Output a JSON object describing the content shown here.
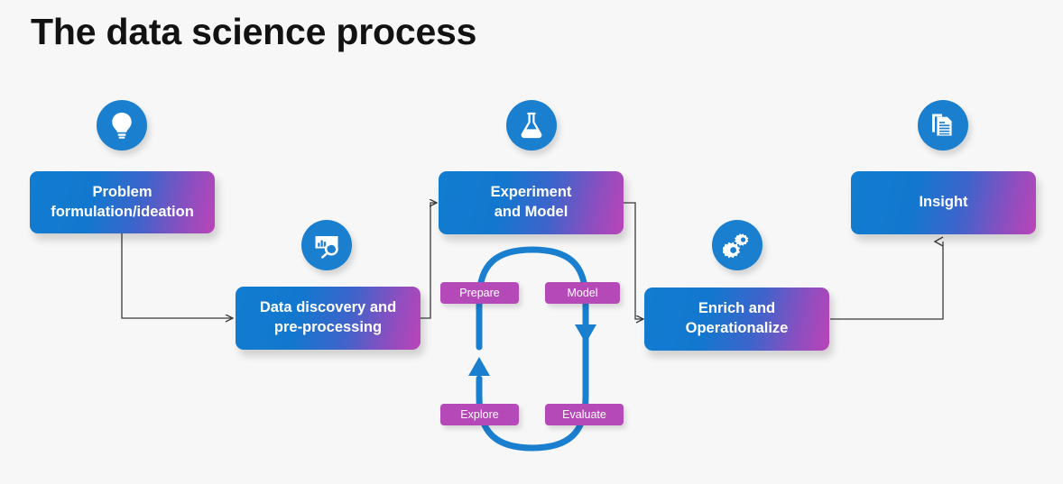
{
  "page": {
    "title": "The data science process",
    "background_color": "#f7f7f7",
    "title_color": "#121212"
  },
  "theme": {
    "box_gradient_start": "#117cd0",
    "box_gradient_end": "#bb44b8",
    "icon_circle_color": "#1b7fd0",
    "pill_color": "#b549b8",
    "cycle_arrow_color": "#1b7fd0",
    "connector_color": "#3a3a3a",
    "box_text_color": "#ffffff",
    "pill_text_color": "#ffffff"
  },
  "stages": [
    {
      "id": "problem",
      "icon": "lightbulb-icon",
      "lines": [
        "Problem",
        "formulation/ideation"
      ]
    },
    {
      "id": "data-discovery",
      "icon": "chart-search-icon",
      "lines": [
        "Data discovery and",
        "pre-processing"
      ]
    },
    {
      "id": "experiment",
      "icon": "flask-icon",
      "lines": [
        "Experiment",
        "and Model"
      ]
    },
    {
      "id": "enrich",
      "icon": "gears-icon",
      "lines": [
        "Enrich and",
        "Operationalize"
      ]
    },
    {
      "id": "insight",
      "icon": "documents-icon",
      "lines": [
        "Insight"
      ]
    }
  ],
  "cycle": {
    "pills": [
      {
        "id": "prepare",
        "label": "Prepare"
      },
      {
        "id": "model",
        "label": "Model"
      },
      {
        "id": "explore",
        "label": "Explore"
      },
      {
        "id": "evaluate",
        "label": "Evaluate"
      }
    ]
  }
}
